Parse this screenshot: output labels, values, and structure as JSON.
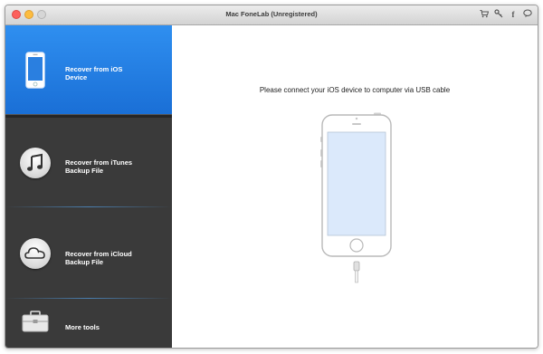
{
  "window": {
    "title": "Mac FoneLab (Unregistered)"
  },
  "toolbar": {
    "icons": [
      "cart-icon",
      "key-icon",
      "facebook-icon",
      "chat-icon"
    ],
    "facebook_glyph": "f"
  },
  "sidebar": {
    "items": [
      {
        "label": "Recover from iOS Device",
        "icon": "iphone-icon",
        "active": true
      },
      {
        "label": "Recover from iTunes Backup File",
        "icon": "music-note-icon"
      },
      {
        "label": "Recover from iCloud Backup File",
        "icon": "cloud-icon"
      },
      {
        "label": "More tools",
        "icon": "toolbox-icon"
      }
    ]
  },
  "main": {
    "message": "Please connect your iOS device to computer via USB cable"
  },
  "colors": {
    "accent": "#1f7ee3",
    "sidebar_bg": "#3a3a3a",
    "screen": "#dbe9fb"
  }
}
